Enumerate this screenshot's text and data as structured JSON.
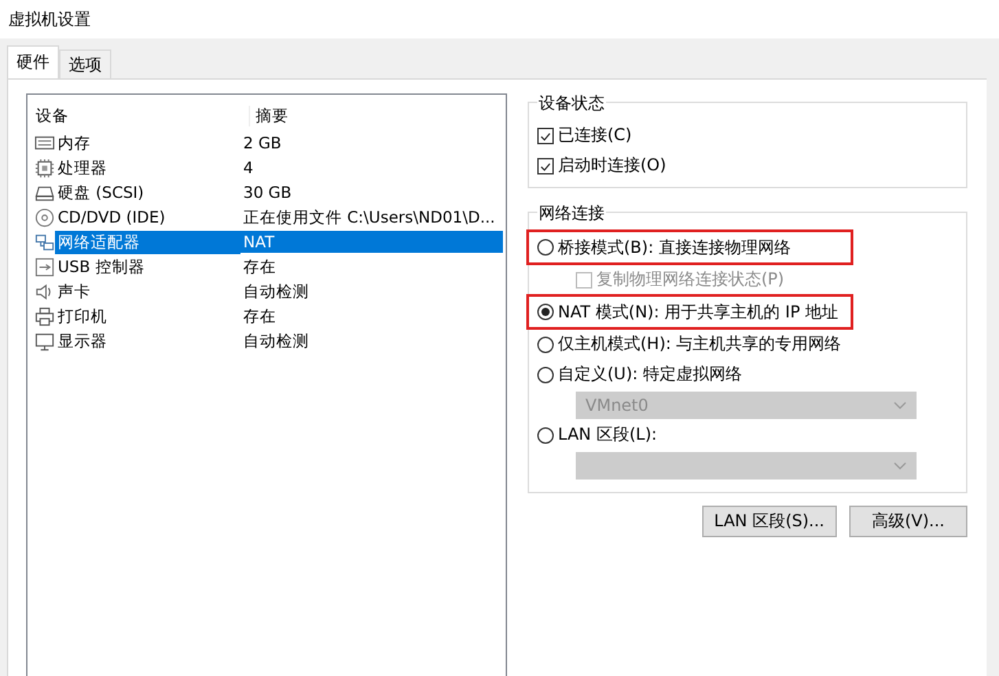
{
  "window": {
    "title": "虚拟机设置"
  },
  "tabs": [
    {
      "label": "硬件",
      "selected": true
    },
    {
      "label": "选项",
      "selected": false
    }
  ],
  "devices": {
    "columns": [
      "设备",
      "摘要"
    ],
    "rows": [
      {
        "kind": "memory",
        "name": "内存",
        "summary": "2 GB",
        "selected": false
      },
      {
        "kind": "cpu",
        "name": "处理器",
        "summary": "4",
        "selected": false
      },
      {
        "kind": "disk",
        "name": "硬盘 (SCSI)",
        "summary": "30 GB",
        "selected": false
      },
      {
        "kind": "cd",
        "name": "CD/DVD (IDE)",
        "summary": "正在使用文件 C:\\Users\\ND01\\D...",
        "selected": false
      },
      {
        "kind": "network",
        "name": "网络适配器",
        "summary": "NAT",
        "selected": true
      },
      {
        "kind": "usb",
        "name": "USB 控制器",
        "summary": "存在",
        "selected": false
      },
      {
        "kind": "sound",
        "name": "声卡",
        "summary": "自动检测",
        "selected": false
      },
      {
        "kind": "printer",
        "name": "打印机",
        "summary": "存在",
        "selected": false
      },
      {
        "kind": "display",
        "name": "显示器",
        "summary": "自动检测",
        "selected": false
      }
    ]
  },
  "device_status": {
    "title": "设备状态",
    "options": [
      {
        "label": "已连接(C)",
        "checked": true
      },
      {
        "label": "启动时连接(O)",
        "checked": true
      }
    ]
  },
  "network_connection": {
    "title": "网络连接",
    "options": [
      {
        "kind": "radio",
        "label": "桥接模式(B): 直接连接物理网络",
        "selected": false,
        "highlighted": true
      },
      {
        "kind": "checkbox",
        "label": "复制物理网络连接状态(P)",
        "checked": false,
        "disabled": true
      },
      {
        "kind": "radio",
        "label": "NAT 模式(N): 用于共享主机的 IP 地址",
        "selected": true,
        "highlighted": true
      },
      {
        "kind": "radio",
        "label": "仅主机模式(H): 与主机共享的专用网络",
        "selected": false,
        "highlighted": false
      },
      {
        "kind": "radio",
        "label": "自定义(U): 特定虚拟网络",
        "selected": false,
        "highlighted": false
      },
      {
        "kind": "dropdown",
        "value": "VMnet0",
        "disabled": true
      },
      {
        "kind": "radio",
        "label": "LAN 区段(L):",
        "selected": false,
        "highlighted": false
      },
      {
        "kind": "dropdown",
        "disabled": true
      }
    ]
  },
  "buttons": [
    "LAN 区段(S)...",
    "高级(V)..."
  ]
}
